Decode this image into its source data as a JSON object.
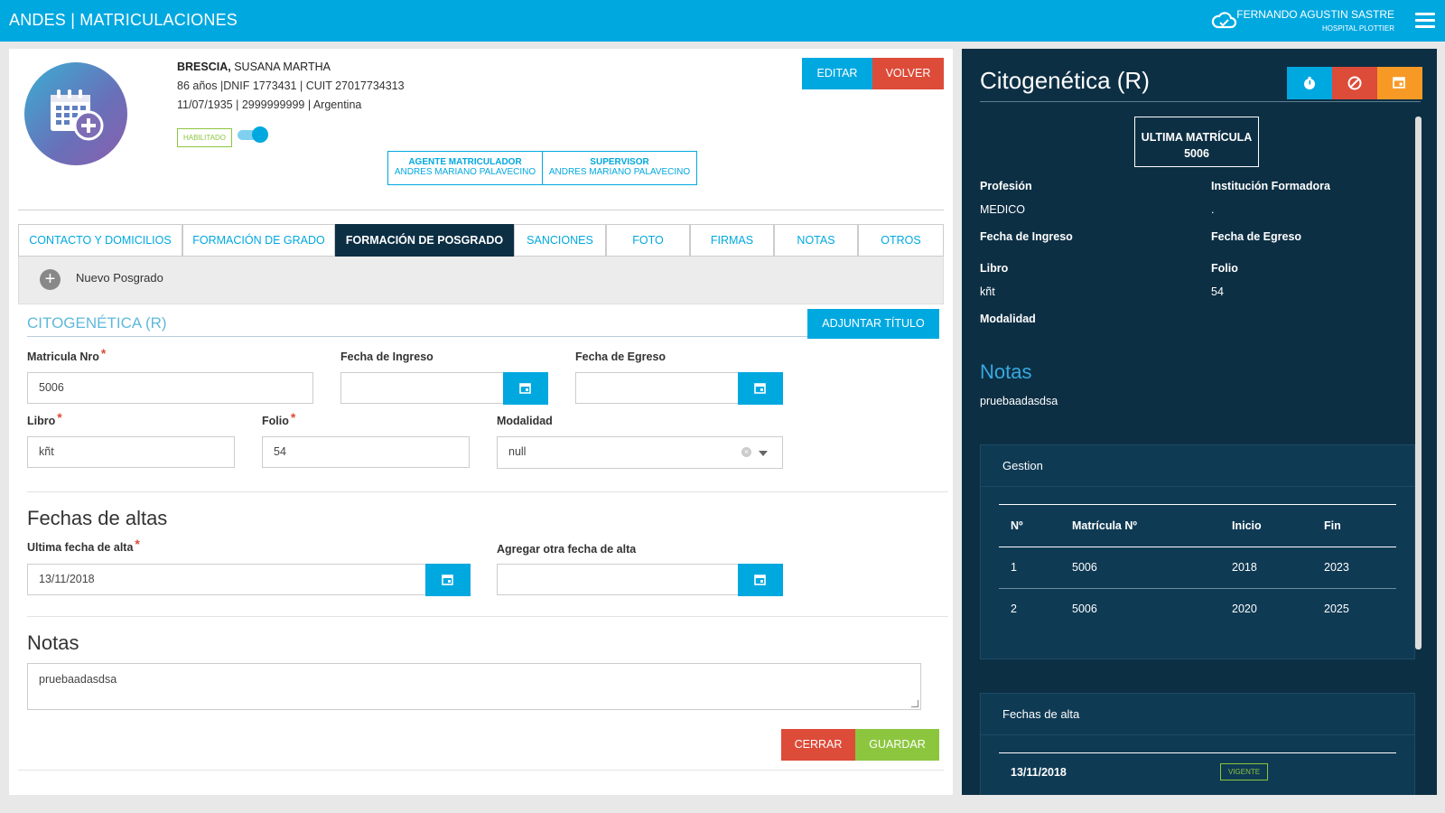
{
  "topbar": {
    "app_title": "ANDES | MATRICULACIONES",
    "user_name": "FERNANDO AGUSTIN SASTRE",
    "user_org": "HOSPITAL PLOTTIER"
  },
  "profile": {
    "last_name": "BRESCIA,",
    "first_names": "SUSANA MARTHA",
    "line2": "86 años |DNIF 1773431 | CUIT 27017734313",
    "line3": "11/07/1935 | 2999999999 | Argentina",
    "status_badge": "HABILITADO",
    "status_enabled": true,
    "agent_role": "AGENTE MATRICULADOR",
    "agent_name": "ANDRES MARIANO PALAVECINO",
    "supervisor_role": "SUPERVISOR",
    "supervisor_name": "ANDRES MARIANO PALAVECINO",
    "edit_label": "EDITAR",
    "back_label": "VOLVER"
  },
  "tabs": [
    {
      "label": "CONTACTO Y DOMICILIOS",
      "active": false
    },
    {
      "label": "FORMACIÓN DE GRADO",
      "active": false
    },
    {
      "label": "FORMACIÓN DE POSGRADO",
      "active": true
    },
    {
      "label": "SANCIONES",
      "active": false
    },
    {
      "label": "FOTO",
      "active": false
    },
    {
      "label": "FIRMAS",
      "active": false
    },
    {
      "label": "NOTAS",
      "active": false
    },
    {
      "label": "OTROS",
      "active": false
    }
  ],
  "subbar": {
    "new_label": "Nuevo Posgrado"
  },
  "form": {
    "section_title": "CITOGENÉTICA (R)",
    "attach_label": "ADJUNTAR TÍTULO",
    "matricula_label": "Matricula Nro",
    "matricula_value": "5006",
    "ingreso_label": "Fecha de Ingreso",
    "ingreso_value": "",
    "egreso_label": "Fecha de Egreso",
    "egreso_value": "",
    "libro_label": "Libro",
    "libro_value": "kñt",
    "folio_label": "Folio",
    "folio_value": "54",
    "modalidad_label": "Modalidad",
    "modalidad_value": "null",
    "altas_heading": "Fechas de altas",
    "ultima_alta_label": "Ultima fecha de alta",
    "ultima_alta_value": "13/11/2018",
    "otra_alta_label": "Agregar otra fecha de alta",
    "otra_alta_value": "",
    "notas_heading": "Notas",
    "notas_value": "pruebaadasdsa",
    "close_label": "CERRAR",
    "save_label": "GUARDAR"
  },
  "detail": {
    "title": "Citogenética (R)",
    "last_matricula_label": "ULTIMA MATRÍCULA",
    "last_matricula_value": "5006",
    "profesion_label": "Profesión",
    "profesion_value": "MEDICO",
    "institucion_label": "Institución Formadora",
    "institucion_value": ".",
    "ingreso_label": "Fecha de Ingreso",
    "egreso_label": "Fecha de Egreso",
    "libro_label": "Libro",
    "libro_value": "kñt",
    "folio_label": "Folio",
    "folio_value": "54",
    "modalidad_label": "Modalidad",
    "notas_heading": "Notas",
    "notas_value": "pruebaadasdsa",
    "gestion": {
      "title": "Gestion",
      "headers": [
        "Nº",
        "Matrícula Nº",
        "Inicio",
        "Fin"
      ],
      "rows": [
        [
          "1",
          "5006",
          "2018",
          "2023"
        ],
        [
          "2",
          "5006",
          "2020",
          "2025"
        ]
      ]
    },
    "altas": {
      "title": "Fechas de alta",
      "rows": [
        {
          "date": "13/11/2018",
          "status": "VIGENTE"
        }
      ]
    }
  },
  "colors": {
    "primary": "#00a8e0",
    "dark": "#0d2f44",
    "danger": "#dd4b39",
    "success": "#8cc63f",
    "warning": "#f79a25"
  },
  "icons": {
    "cloud": "cloud-icon",
    "menu": "hamburger-menu-icon",
    "calendar": "calendar-icon",
    "timer": "stopwatch-icon",
    "cancel": "ban-icon"
  }
}
